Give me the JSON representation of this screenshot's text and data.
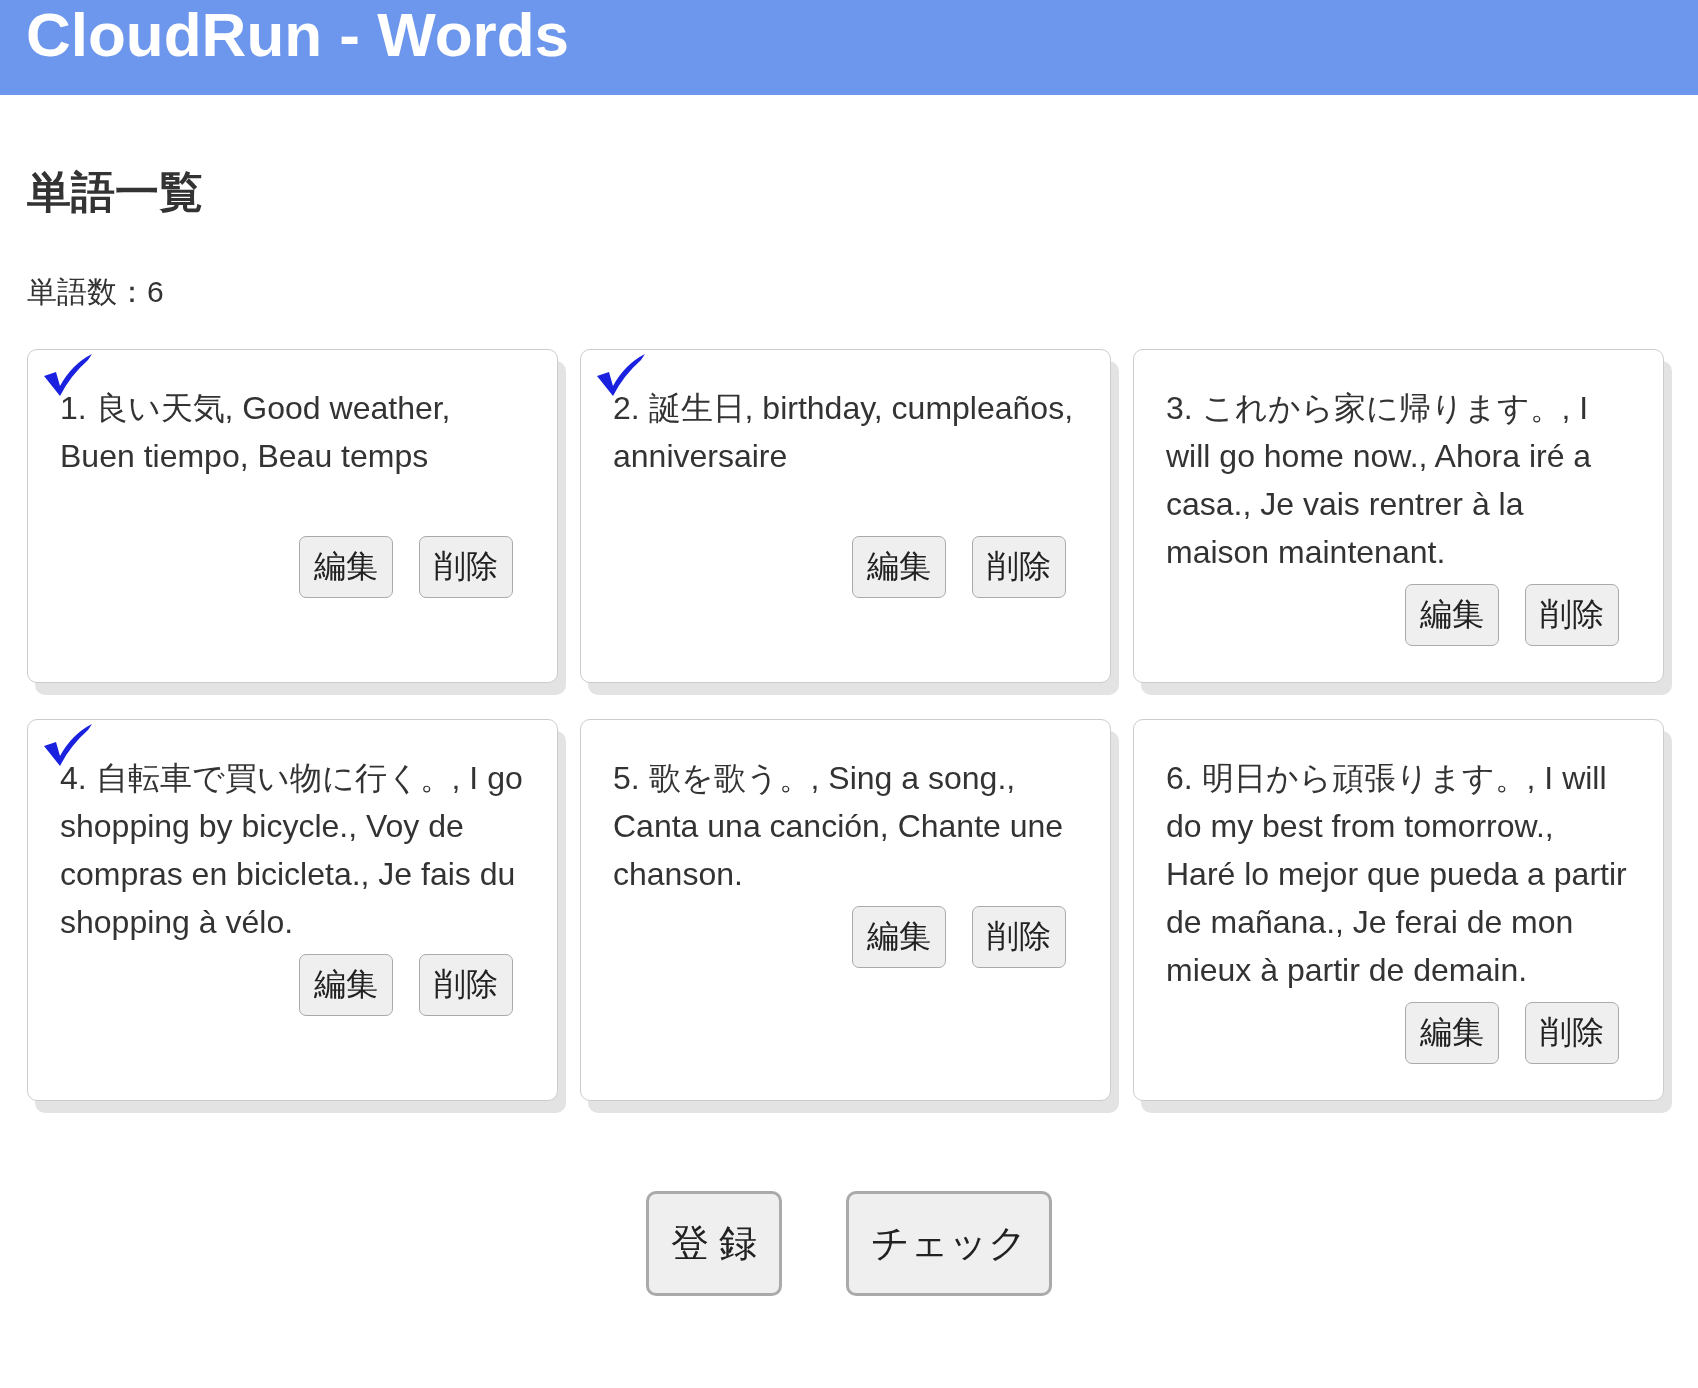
{
  "header": {
    "title": "CloudRun - Words"
  },
  "heading": "単語一覧",
  "count": "単語数：6",
  "words": [
    {
      "text": "1. 良い天気, Good weather, Buen tiempo, Beau temps",
      "checked": true,
      "buttons": [
        "編集",
        "削除"
      ]
    },
    {
      "text": "2. 誕生日, birthday, cumpleaños, anniversaire",
      "checked": true,
      "buttons": [
        "編集",
        "削除"
      ]
    },
    {
      "text": "3. これから家に帰ります。, I will go home now., Ahora iré a casa., Je vais rentrer à la maison maintenant.",
      "checked": false,
      "buttons": [
        "編集",
        "削除"
      ]
    },
    {
      "text": "4. 自転車で買い物に行く。, I go shopping by bicycle., Voy de compras en bicicleta., Je fais du shopping à vélo.",
      "checked": true,
      "buttons": [
        "編集",
        "削除"
      ]
    },
    {
      "text": "5. 歌を歌う。, Sing a song., Canta una canción, Chante une chanson.",
      "checked": false,
      "buttons": [
        "編集",
        "削除"
      ]
    },
    {
      "text": "6. 明日から頑張ります。, I will do my best from tomorrow., Haré lo mejor que pueda a partir de mañana., Je ferai de mon mieux à partir de demain.",
      "checked": false,
      "buttons": [
        "編集",
        "削除"
      ]
    }
  ],
  "actions": [
    "登 録",
    "チェック"
  ]
}
